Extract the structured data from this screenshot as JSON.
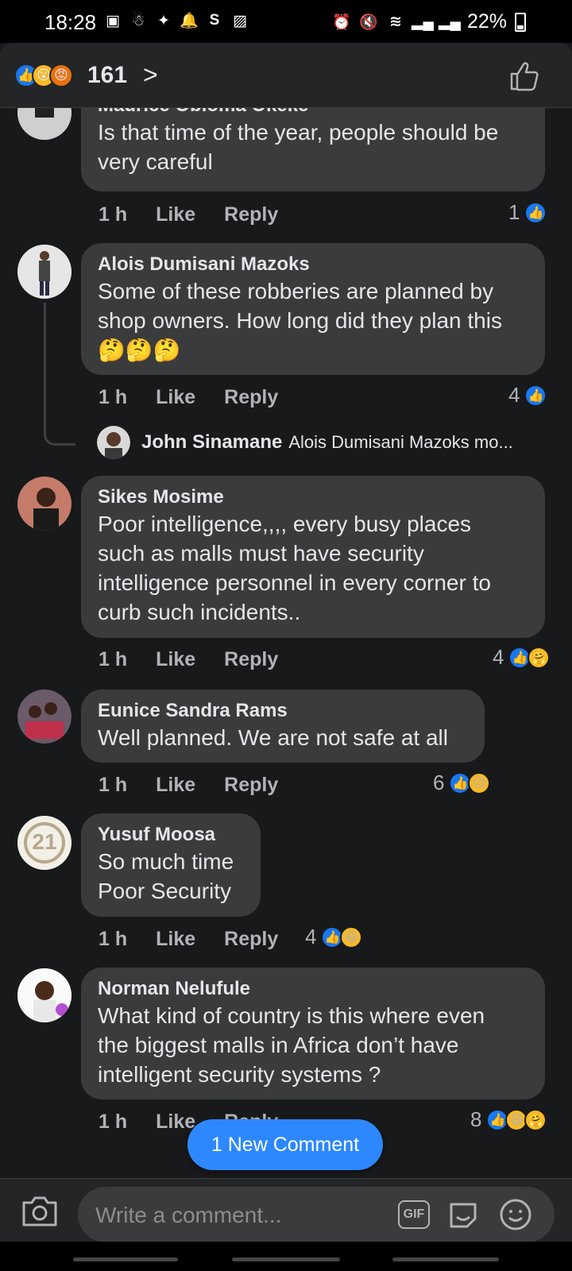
{
  "status": {
    "time": "18:28",
    "battery": "22%"
  },
  "header": {
    "reaction_count": "161",
    "chevron": ">"
  },
  "comments": [
    {
      "author": "Maurice Obioma Okeke",
      "text_lines": [
        "Is that time of the year, people should be",
        "very careful"
      ],
      "time": "1 h",
      "like": "Like",
      "reply": "Reply",
      "reactions": "1"
    },
    {
      "author": "Alois Dumisani Mazoks",
      "text_lines": [
        "Some of these robberies are planned by",
        "shop owners. How long did they plan this",
        "🤔🤔🤔"
      ],
      "time": "1 h",
      "like": "Like",
      "reply": "Reply",
      "reactions": "4",
      "reply_preview": {
        "author": "John Sinamane",
        "text": "Alois Dumisani Mazoks mo..."
      }
    },
    {
      "author": "Sikes Mosime",
      "text_lines": [
        "Poor intelligence,,,, every busy places",
        "such as malls must have security",
        "intelligence personnel in every corner to",
        "curb such incidents.."
      ],
      "time": "1 h",
      "like": "Like",
      "reply": "Reply",
      "reactions": "4"
    },
    {
      "author": "Eunice Sandra Rams",
      "text_lines": [
        "Well planned. We are not safe at all"
      ],
      "time": "1 h",
      "like": "Like",
      "reply": "Reply",
      "reactions": "6"
    },
    {
      "author": "Yusuf Moosa",
      "avatar_text": "21",
      "text_lines": [
        "So much time",
        "Poor Security"
      ],
      "time": "1 h",
      "like": "Like",
      "reply": "Reply",
      "reactions": "4"
    },
    {
      "author": "Norman Nelufule",
      "text_lines": [
        "What kind of country is this where even",
        "the biggest malls in Africa don’t have",
        "intelligent security systems ?"
      ],
      "time": "1 h",
      "like": "Like",
      "reply": "Reply",
      "reactions": "8"
    }
  ],
  "new_comment_pill": "1 New Comment",
  "composer": {
    "placeholder": "Write a comment...",
    "gif_label": "GIF"
  },
  "colors": {
    "background": "#18191a",
    "bubble": "#3a3b3c",
    "accent": "#1877f2",
    "pill": "#2d88ff"
  }
}
